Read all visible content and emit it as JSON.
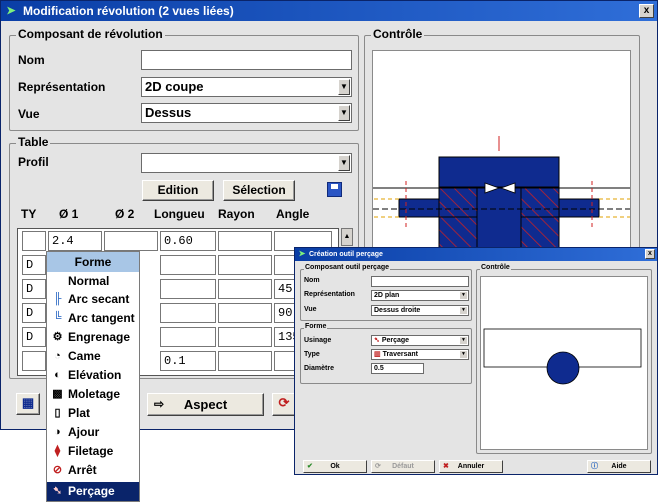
{
  "main_window": {
    "title": "Modification révolution (2 vues liées)",
    "close": "x",
    "composant_group": "Composant de révolution",
    "nom_label": "Nom",
    "nom_value": "",
    "representation_label": "Représentation",
    "representation_value": "2D coupe",
    "vue_label": "Vue",
    "vue_value": "Dessus",
    "controle_group": "Contrôle",
    "table_group": "Table",
    "profil_label": "Profil",
    "profil_value": "",
    "edition_button": "Edition",
    "selection_button": "Sélection",
    "columns": [
      "TY",
      "Ø 1",
      "Ø 2",
      "Longueu",
      "Rayon",
      "Angle"
    ],
    "rows": [
      [
        "",
        "2.4",
        "",
        "0.60",
        "",
        ""
      ],
      [
        "D",
        "",
        "",
        "",
        "",
        ""
      ],
      [
        "D",
        "",
        "",
        "",
        "",
        "45"
      ],
      [
        "D",
        "",
        "",
        "",
        "",
        "90"
      ],
      [
        "D",
        "",
        "",
        "",
        "",
        "135"
      ],
      [
        "",
        "",
        "",
        "0.1",
        "",
        ""
      ]
    ],
    "aspect_button": "Aspect"
  },
  "forme_menu": {
    "header": "Forme",
    "items": [
      {
        "label": "Normal",
        "icon": "none-icon"
      },
      {
        "label": "Arc secant",
        "icon": "arc-secant-icon"
      },
      {
        "label": "Arc tangent",
        "icon": "arc-tangent-icon"
      },
      {
        "label": "Engrenage",
        "icon": "gear-icon"
      },
      {
        "label": "Came",
        "icon": "cam-icon"
      },
      {
        "label": "Elévation",
        "icon": "elevation-icon"
      },
      {
        "label": "Moletage",
        "icon": "knurling-icon"
      },
      {
        "label": "Plat",
        "icon": "flat-icon"
      },
      {
        "label": "Ajour",
        "icon": "cutout-icon"
      },
      {
        "label": "Filetage",
        "icon": "thread-icon"
      },
      {
        "label": "Arrêt",
        "icon": "stop-icon"
      },
      {
        "label": "Perçage",
        "icon": "drill-icon"
      }
    ],
    "selected": "Perçage"
  },
  "dialog": {
    "title": "Création outil perçage",
    "composant_group": "Composant outil perçage",
    "controle_group": "Contrôle",
    "nom_label": "Nom",
    "nom_value": "",
    "representation_label": "Représentation",
    "representation_value": "2D plan",
    "vue_label": "Vue",
    "vue_value": "Dessus droite",
    "forme_group": "Forme",
    "usinage_label": "Usinage",
    "usinage_value": "Perçage",
    "type_label": "Type",
    "type_value": "Traversant",
    "diametre_label": "Diamètre",
    "diametre_value": "0.5",
    "ok_button": "Ok",
    "defaut_button": "Défaut",
    "annuler_button": "Annuler",
    "aide_button": "Aide"
  },
  "colors": {
    "title_bar": "#0a3ea6",
    "part_fill": "#0f2b8f",
    "hatch": "#d02020",
    "menu_selected": "#0a246a",
    "menu_header": "#a8c6e6"
  }
}
